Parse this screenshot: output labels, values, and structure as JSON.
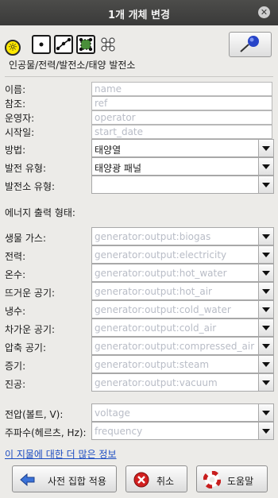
{
  "window": {
    "title": "1개 개체 변경",
    "close_glyph": "✕"
  },
  "preset": {
    "path": "인공물/전력/발전소/태양 발전소"
  },
  "basic": {
    "name_label": "이름:",
    "name_placeholder": "name",
    "ref_label": "참조:",
    "ref_placeholder": "ref",
    "operator_label": "운영자:",
    "operator_placeholder": "operator",
    "start_label": "시작일:",
    "start_placeholder": "start_date",
    "method_label": "방법:",
    "method_value": "태양열",
    "gen_type_label": "발전 유형:",
    "gen_type_value": "태양광 패널",
    "plant_type_label": "발전소 유형:",
    "plant_type_value": ""
  },
  "output": {
    "heading": "에너지 출력 형태:",
    "rows": [
      {
        "label": "생물 가스:",
        "placeholder": "generator:output:biogas"
      },
      {
        "label": "전력:",
        "placeholder": "generator:output:electricity"
      },
      {
        "label": "온수:",
        "placeholder": "generator:output:hot_water"
      },
      {
        "label": "뜨거운 공기:",
        "placeholder": "generator:output:hot_air"
      },
      {
        "label": "냉수:",
        "placeholder": "generator:output:cold_water"
      },
      {
        "label": "차가운 공기:",
        "placeholder": "generator:output:cold_air"
      },
      {
        "label": "압축 공기:",
        "placeholder": "generator:output:compressed_air"
      },
      {
        "label": "증기:",
        "placeholder": "generator:output:steam"
      },
      {
        "label": "진공:",
        "placeholder": "generator:output:vacuum"
      }
    ]
  },
  "electrical": {
    "voltage_label": "전압(볼트, V):",
    "voltage_placeholder": "voltage",
    "frequency_label": "주파수(헤르츠, Hz):",
    "frequency_placeholder": "frequency"
  },
  "more_link": "이 지물에 대한 더 많은 정보",
  "buttons": {
    "apply": "사전 집합 적용",
    "cancel": "취소",
    "help": "도움말"
  }
}
